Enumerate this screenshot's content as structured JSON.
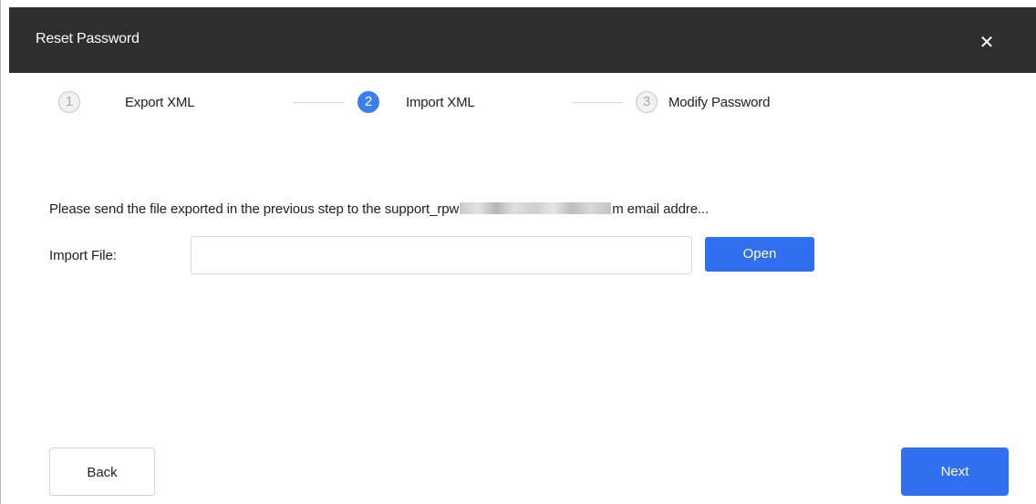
{
  "window": {
    "title": "Reset Password",
    "close_icon": "close-icon",
    "close_glyph": "✕"
  },
  "steps": [
    {
      "number": "1",
      "label": "Export XML",
      "state": "done"
    },
    {
      "number": "2",
      "label": "Import XML",
      "state": "current"
    },
    {
      "number": "3",
      "label": "Modify Password",
      "state": "pending"
    }
  ],
  "main": {
    "message_prefix": "Please send the file exported in the previous step to the support_rpw",
    "message_suffix": "m email addre...",
    "import_label": "Import File:",
    "import_value": "",
    "import_placeholder": "",
    "open_label": "Open"
  },
  "footer": {
    "back_label": "Back",
    "next_label": "Next"
  },
  "colors": {
    "titlebar": "#2e2e2e",
    "accent": "#2f6ff0",
    "inactive_step": "#f1f1f1"
  }
}
